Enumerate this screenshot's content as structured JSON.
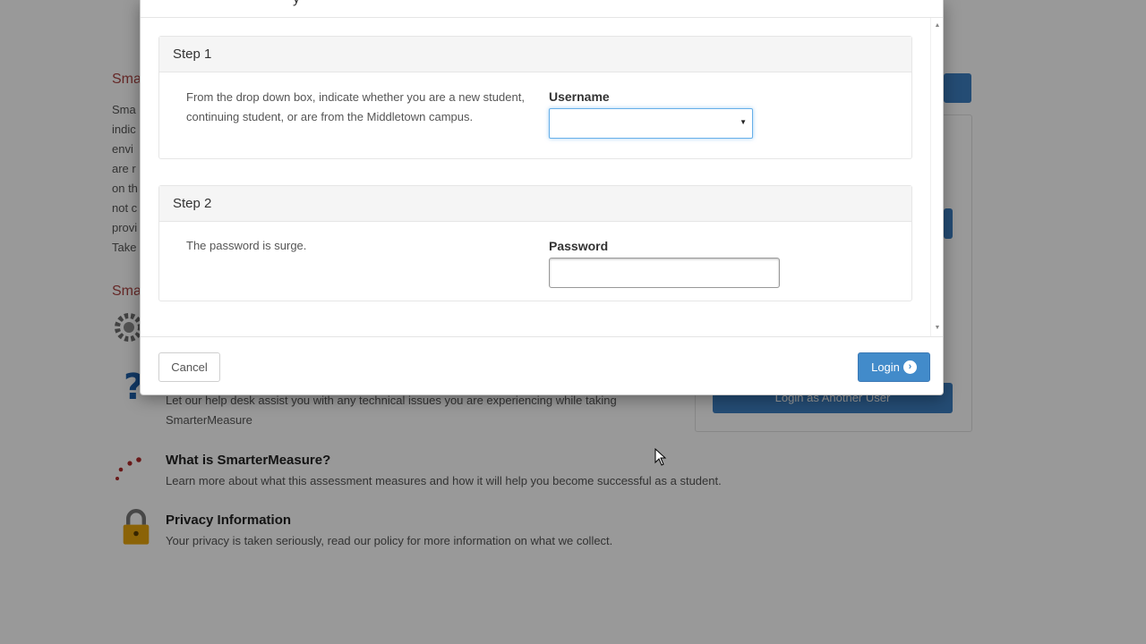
{
  "background": {
    "section_title_1": "Sma",
    "intro_lines": [
      "Sma",
      "indic",
      "envi",
      "are r",
      "on th",
      "not c",
      "provi",
      "Take"
    ],
    "section_title_2": "Sma",
    "login_another_user": "Login as Another User",
    "items": [
      {
        "title": "",
        "desc": "Let our help desk assist you with any technical issues you are experiencing while taking",
        "desc2": "SmarterMeasure"
      },
      {
        "title": "What is SmarterMeasure?",
        "desc": "Learn more about what this assessment measures and how it will help you become successful as a student."
      },
      {
        "title": "Privacy Information",
        "desc": "Your privacy is taken seriously, read our policy for more information on what we collect."
      }
    ]
  },
  "modal": {
    "title_fragment": "y",
    "step1": {
      "heading": "Step 1",
      "text": "From the drop down box, indicate whether you are a new student, continuing student, or are from the Middletown campus.",
      "field_label": "Username",
      "select_value": ""
    },
    "step2": {
      "heading": "Step 2",
      "text": "The password is surge.",
      "field_label": "Password",
      "password_value": ""
    },
    "footer": {
      "cancel_label": "Cancel",
      "login_label": "Login"
    }
  },
  "colors": {
    "accent": "#428bca",
    "section_title": "#a94442",
    "overlay": "rgba(0,0,0,0.40)"
  },
  "icons": {
    "login": "circle-arrow-right-icon",
    "select_caret": "caret-down-icon",
    "gear": "gear-icon",
    "help": "question-mark-icon",
    "dots": "dots-icon",
    "lock": "lock-icon"
  }
}
